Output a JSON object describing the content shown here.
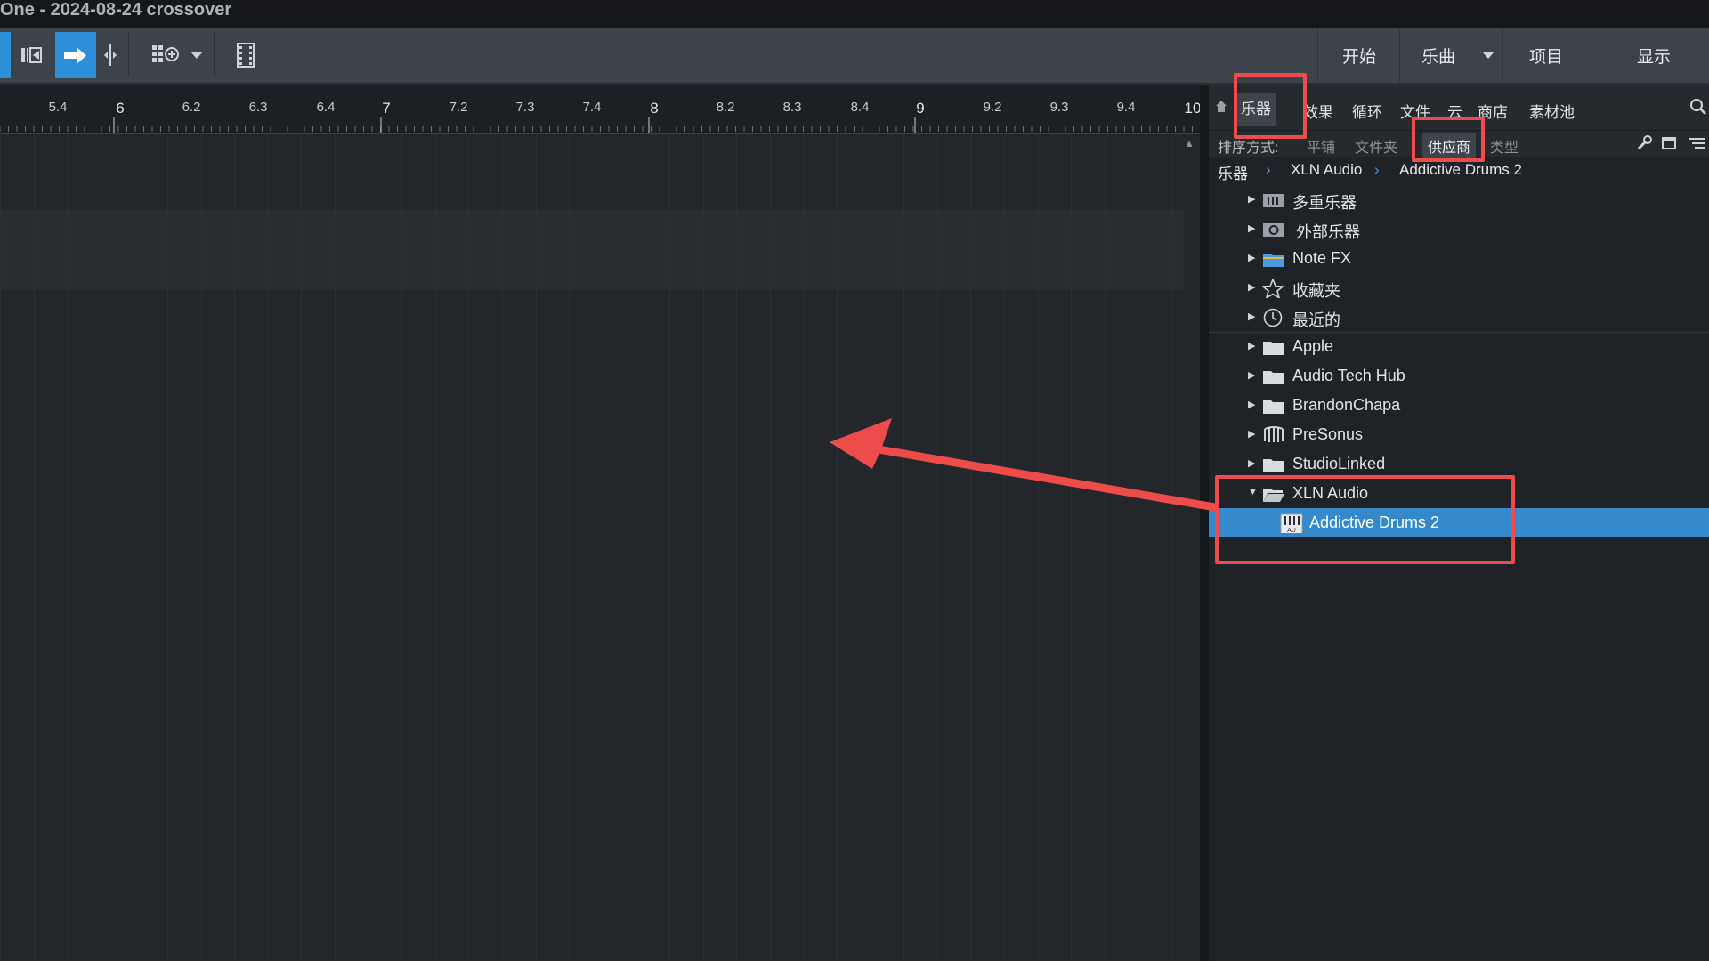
{
  "window": {
    "title": "One - 2024-08-24 crossover"
  },
  "toolbar": {
    "nav_tabs": [
      "开始",
      "乐曲",
      "项目",
      "显示"
    ]
  },
  "timeline": {
    "ruler_labels": [
      "5.4",
      "6",
      "6.2",
      "6.3",
      "6.4",
      "7",
      "7.2",
      "7.3",
      "7.4",
      "8",
      "8.2",
      "8.3",
      "8.4",
      "9",
      "9.2",
      "9.3",
      "9.4",
      "10"
    ]
  },
  "browser": {
    "tabs": [
      "乐器",
      "效果",
      "循环",
      "文件",
      "云",
      "商店",
      "素材池"
    ],
    "active_tab": "乐器",
    "sort_label": "排序方式:",
    "sort_options": [
      "平铺",
      "文件夹",
      "供应商",
      "类型"
    ],
    "active_sort": "供应商",
    "breadcrumb": [
      "乐器",
      "XLN Audio",
      "Addictive Drums 2"
    ],
    "tree": [
      {
        "label": "多重乐器",
        "icon": "multi-instrument-icon"
      },
      {
        "label": "外部乐器",
        "icon": "external-instrument-icon"
      },
      {
        "label": "Note FX",
        "icon": "folder-blue-icon"
      },
      {
        "label": "收藏夹",
        "icon": "star-icon"
      },
      {
        "label": "最近的",
        "icon": "clock-icon"
      },
      {
        "label": "Apple",
        "icon": "folder-icon"
      },
      {
        "label": "Audio Tech Hub",
        "icon": "folder-icon"
      },
      {
        "label": "BrandonChapa",
        "icon": "folder-icon"
      },
      {
        "label": "PreSonus",
        "icon": "presonus-icon"
      },
      {
        "label": "StudioLinked",
        "icon": "folder-icon"
      },
      {
        "label": "XLN Audio",
        "icon": "folder-open-icon",
        "expanded": true
      },
      {
        "label": "Addictive Drums 2",
        "icon": "au-plugin-icon",
        "selected": true
      }
    ]
  },
  "annotations": {
    "color": "#ee4b4b"
  }
}
